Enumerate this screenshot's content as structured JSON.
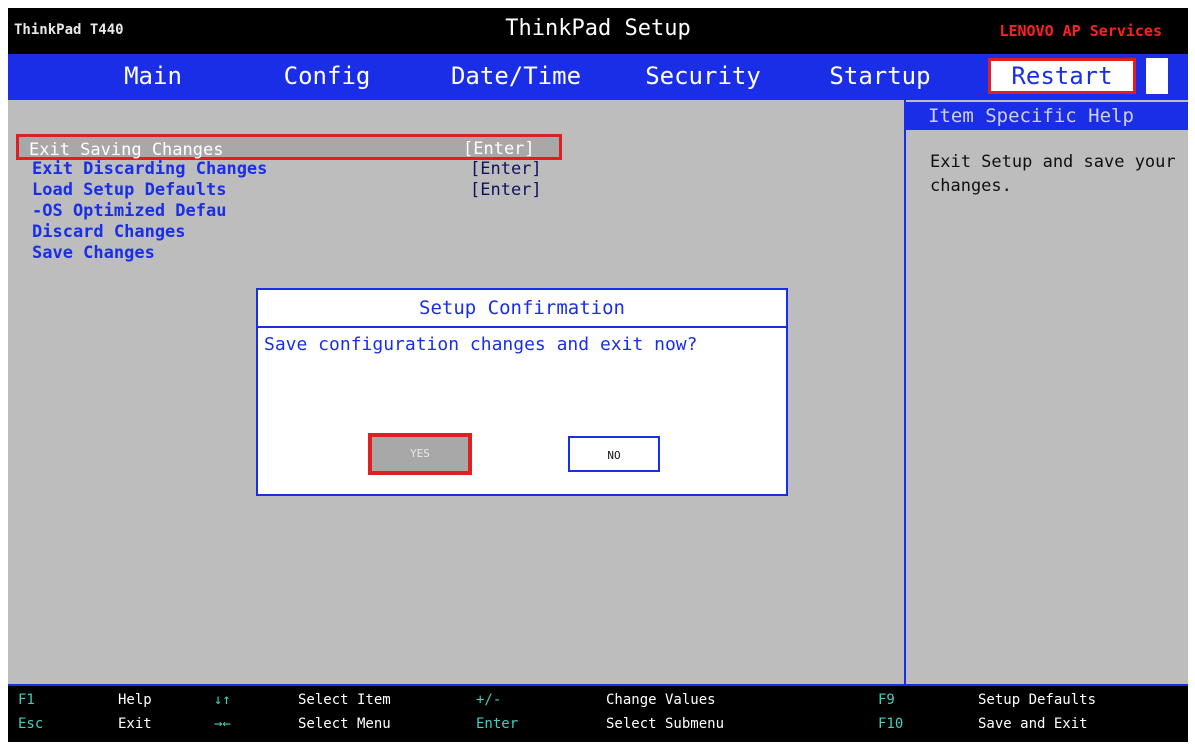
{
  "header": {
    "model": "ThinkPad T440",
    "title": "ThinkPad Setup",
    "vendor": "LENOVO AP Services"
  },
  "tabs": [
    {
      "label": "Main"
    },
    {
      "label": "Config"
    },
    {
      "label": "Date/Time"
    },
    {
      "label": "Security"
    },
    {
      "label": "Startup"
    },
    {
      "label": "Restart"
    }
  ],
  "active_tab": "Restart",
  "menu": {
    "items": [
      {
        "label": "Exit Saving Changes",
        "value": "[Enter]"
      },
      {
        "label": "Exit Discarding Changes",
        "value": "[Enter]"
      },
      {
        "label": "Load Setup Defaults",
        "value": "[Enter]"
      },
      {
        "label": "-OS Optimized Defau",
        "value": ""
      },
      {
        "label": "Discard Changes",
        "value": ""
      },
      {
        "label": "Save Changes",
        "value": ""
      }
    ]
  },
  "help": {
    "header": "Item Specific Help",
    "text": "Exit Setup and save your changes."
  },
  "dialog": {
    "title": "Setup Confirmation",
    "message": "Save configuration changes and exit now?",
    "yes_label": "YES",
    "no_label": "NO"
  },
  "footer": {
    "row1": [
      {
        "key": "F1",
        "desc": "Help"
      },
      {
        "key": "↓↑",
        "desc": "Select Item"
      },
      {
        "key": "+/-",
        "desc": "Change Values"
      },
      {
        "key": "F9",
        "desc": "Setup Defaults"
      }
    ],
    "row2": [
      {
        "key": "Esc",
        "desc": "Exit"
      },
      {
        "key": "→←",
        "desc": "Select Menu"
      },
      {
        "key": "Enter",
        "desc": "Select Submenu"
      },
      {
        "key": "F10",
        "desc": "Save and Exit"
      }
    ]
  },
  "colors": {
    "menu_blue": "#1a2ee8",
    "panel_gray": "#bdbdbd",
    "highlight_red": "#e02020",
    "footer_key": "#3fd0c0"
  }
}
